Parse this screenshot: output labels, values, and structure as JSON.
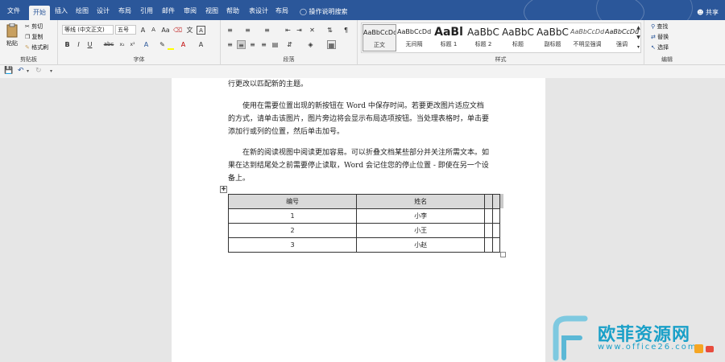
{
  "tabs": [
    "文件",
    "开始",
    "插入",
    "绘图",
    "设计",
    "布局",
    "引用",
    "邮件",
    "审阅",
    "视图",
    "帮助",
    "表设计",
    "布局"
  ],
  "tell_me": "操作说明搜索",
  "share": "共享",
  "clipboard": {
    "paste": "粘贴",
    "cut": "剪切",
    "copy": "复制",
    "format_painter": "格式刷",
    "label": "剪贴板"
  },
  "font": {
    "name": "等线 (中文正文)",
    "size": "五号",
    "label": "字体",
    "bold": "B",
    "italic": "I",
    "underline": "U",
    "strike": "abc"
  },
  "paragraph": {
    "label": "段落"
  },
  "styles": {
    "label": "样式",
    "items": [
      {
        "sample": "AaBbCcDd",
        "name": "正文"
      },
      {
        "sample": "AaBbCcDd",
        "name": "无间隔"
      },
      {
        "sample": "AaBl",
        "name": "标题 1"
      },
      {
        "sample": "AaBbC",
        "name": "标题 2"
      },
      {
        "sample": "AaBbC",
        "name": "标题"
      },
      {
        "sample": "AaBbC",
        "name": "副标题"
      },
      {
        "sample": "AaBbCcDd",
        "name": "不明显强调"
      },
      {
        "sample": "AaBbCcDd",
        "name": "强调"
      }
    ]
  },
  "editing": {
    "find": "查找",
    "replace": "替换",
    "select": "选择",
    "label": "编辑"
  },
  "document": {
    "paragraphs": [
      "行更改以匹配新的主题。",
      "使用在需要位置出现的新按钮在 Word 中保存时间。若要更改图片适应文档的方式，请单击该图片，图片旁边将会显示布局选项按钮。当处理表格时，单击要添加行或列的位置，然后单击加号。",
      "在新的阅读视图中阅读更加容易。可以折叠文档某些部分并关注所需文本。如果在达到结尾处之前需要停止读取，Word 会记住您的停止位置 - 即使在另一个设备上。"
    ],
    "table": {
      "headers": [
        "编号",
        "姓名",
        "",
        ""
      ],
      "rows": [
        [
          "1",
          "小李",
          "",
          ""
        ],
        [
          "2",
          "小王",
          "",
          ""
        ],
        [
          "3",
          "小赵",
          "",
          ""
        ]
      ]
    }
  },
  "watermark": {
    "text": "欧菲资源网",
    "url": "www.office26.com"
  },
  "colors": {
    "accent": "#2b579a",
    "watermark": "#1aa0c8"
  }
}
